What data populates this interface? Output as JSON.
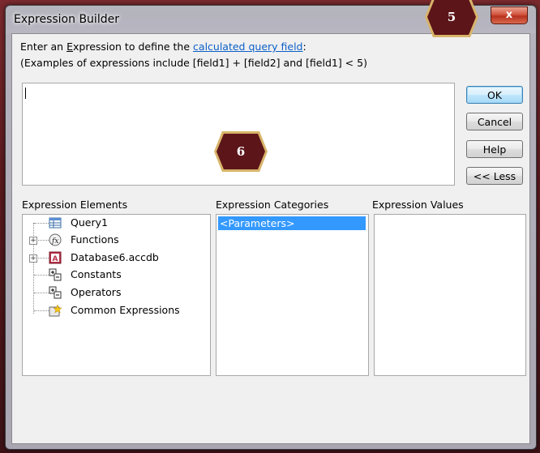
{
  "window": {
    "title": "Expression Builder",
    "close_label": "x"
  },
  "instructions": {
    "line1_prefix": "Enter an ",
    "line1_accel": "E",
    "line1_mid": "xpression to define the ",
    "line1_link": "calculated query field",
    "line1_suffix": ":",
    "line2": "(Examples of expressions include [field1] + [field2] and [field1] < 5)"
  },
  "expression": {
    "value": ""
  },
  "buttons": {
    "ok": "OK",
    "cancel": "Cancel",
    "help": "Help",
    "less": "<< Less"
  },
  "panes": {
    "elements_label": "Expression Elements",
    "categories_label": "Expression Categories",
    "values_label": "Expression Values"
  },
  "elements": [
    {
      "label": "Query1",
      "icon": "query-icon"
    },
    {
      "label": "Functions",
      "icon": "function-icon"
    },
    {
      "label": "Database6.accdb",
      "icon": "database-icon"
    },
    {
      "label": "Constants",
      "icon": "constants-icon"
    },
    {
      "label": "Operators",
      "icon": "operators-icon"
    },
    {
      "label": "Common Expressions",
      "icon": "common-expressions-icon"
    }
  ],
  "categories": [
    {
      "label": "<Parameters>",
      "selected": true
    }
  ],
  "annotations": {
    "badge_5": "5",
    "badge_6": "6"
  },
  "colors": {
    "selection": "#3399ff",
    "link": "#0b5fc8",
    "close": "#d2553f",
    "badge": "#5c1519"
  }
}
